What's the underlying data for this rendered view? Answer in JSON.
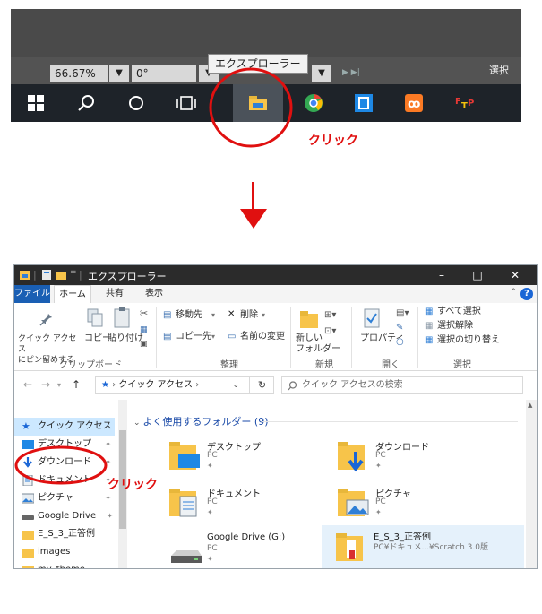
{
  "top": {
    "zoom_value": "66.67%",
    "rotation_value": "0°",
    "tooltip": "エクスプローラー",
    "select_label": "選択",
    "annotation": "クリック"
  },
  "explorer": {
    "title": "エクスプローラー",
    "win_minimize": "–",
    "win_maximize": "□",
    "win_close": "✕",
    "tabs": {
      "file": "ファイル",
      "home": "ホーム",
      "share": "共有",
      "view": "表示"
    },
    "ribbon": {
      "pin_quick_access": "クイック アクセス\nにピン留めする",
      "copy": "コピー",
      "paste": "貼り付け",
      "clipboard_group": "クリップボード",
      "move_to": "移動先",
      "copy_to": "コピー先",
      "delete": "削除",
      "rename": "名前の変更",
      "organize_group": "整理",
      "new_folder": "新しい\nフォルダー",
      "new_group": "新規",
      "properties": "プロパティ",
      "open_group": "開く",
      "select_all": "すべて選択",
      "select_none": "選択解除",
      "invert_selection": "選択の切り替え",
      "select_group": "選択"
    },
    "address": "クイック アクセス",
    "search_placeholder": "クイック アクセスの検索",
    "nav": {
      "items": [
        "クイック アクセス",
        "デスクトップ",
        "ダウンロード",
        "ドキュメント",
        "ピクチャ",
        "Google Drive",
        "E_S_3_正答例",
        "images",
        "my_theme"
      ]
    },
    "group_header": "よく使用するフォルダー (9)",
    "tiles": [
      {
        "name": "デスクトップ",
        "sub": "PC"
      },
      {
        "name": "ダウンロード",
        "sub": "PC"
      },
      {
        "name": "ドキュメント",
        "sub": "PC"
      },
      {
        "name": "ピクチャ",
        "sub": "PC"
      },
      {
        "name": "Google Drive (G:)",
        "sub": "PC"
      },
      {
        "name": "E_S_3_正答例",
        "sub": "PC¥ドキュメ...¥Scratch 3.0版"
      }
    ],
    "annotation": "クリック"
  },
  "colors": {
    "accent_red": "#e01010",
    "file_tab": "#1a5fb4",
    "folder": "#f7c44a"
  }
}
